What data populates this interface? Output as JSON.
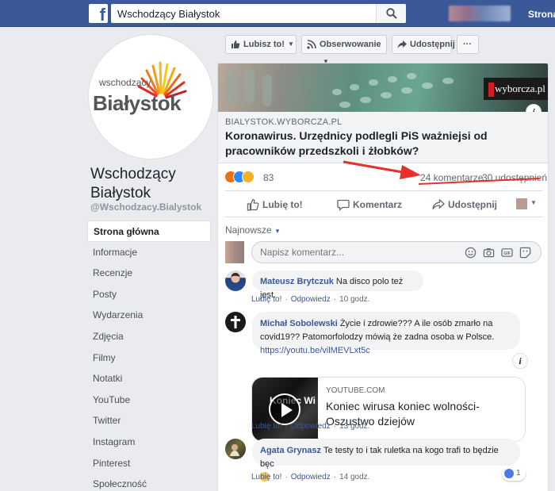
{
  "topbar": {
    "logo": "f",
    "search_value": "Wschodzący Białystok",
    "home_label": "Strona"
  },
  "page": {
    "logo_small": "wschodzący",
    "logo_big": "Białystok",
    "name": "Wschodzący Białystok",
    "handle": "@Wschodzacy.Bialystok"
  },
  "nav": {
    "items": [
      {
        "label": "Strona główna",
        "active": true
      },
      {
        "label": "Informacje"
      },
      {
        "label": "Recenzje"
      },
      {
        "label": "Posty"
      },
      {
        "label": "Wydarzenia"
      },
      {
        "label": "Zdjęcia"
      },
      {
        "label": "Filmy"
      },
      {
        "label": "Notatki"
      },
      {
        "label": "YouTube"
      },
      {
        "label": "Twitter"
      },
      {
        "label": "Instagram"
      },
      {
        "label": "Pinterest"
      },
      {
        "label": "Społeczność"
      }
    ]
  },
  "actions": {
    "like_page": "Lubisz to!",
    "follow": "Obserwowanie",
    "share": "Udostępnij",
    "more": "···"
  },
  "post": {
    "image_badge": "wyborcza.pl",
    "info_badge": "i",
    "link_domain": "BIALYSTOK.WYBORCZA.PL",
    "link_title": "Koronawirus. Urzędnicy podlegli PiS ważniejsi od pracowników przedszkoli i żłobków?",
    "reaction_count": "83",
    "comments_count": "24 komentarze",
    "shares_count": "30 udostępnień",
    "like_btn": "Lubię to!",
    "comment_btn": "Komentarz",
    "share_btn": "Udostępnij",
    "sort_label": "Najnowsze",
    "comment_placeholder": "Napisz komentarz..."
  },
  "comments": [
    {
      "author": "Mateusz Brytczuk",
      "text": "Na disco polo też jest.",
      "like": "Lubię to!",
      "reply": "Odpowiedz",
      "time": "10 godz."
    },
    {
      "author": "Michał Sobolewski",
      "text": "Życie i zdrowie??? A ile osób zmarło na covid19?? Patomorfolodzy mówią że zadna osoba w Polsce.",
      "link": "https://youtu.be/vilMEVLxt5c",
      "yt_thumb_text": "Koniec Wi koniec",
      "yt_domain": "YOUTUBE.COM",
      "yt_title": "Koniec wirusa koniec wolności- Oszustwo dziejów",
      "like": "Lubię to!",
      "reply": "Odpowiedz",
      "time": "13 godz."
    },
    {
      "author": "Agata Grynasz",
      "text": "Te testy to i tak ruletka na kogo trafi to będzie bęc",
      "like": "Lubię to!",
      "reply": "Odpowiedz",
      "time": "14 godz.",
      "reactions": "1"
    }
  ],
  "colors": {
    "brand": "#3b5998",
    "link": "#385898",
    "annotation_arrow": "#e8302b"
  }
}
